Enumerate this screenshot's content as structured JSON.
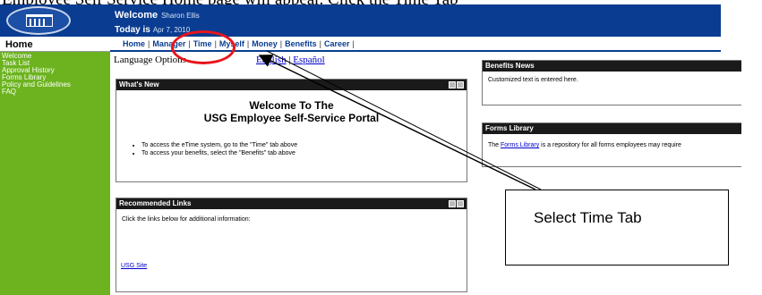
{
  "caption": "Employee Self Service Home page will appear. Click the Time Tab",
  "header": {
    "welcome_label": "Welcome",
    "user_name": "Sharon Ellis",
    "today_label": "Today is",
    "date": "Apr 7, 2010"
  },
  "home_label": "Home",
  "nav_tabs": [
    "Home",
    "Manager",
    "Time",
    "Myself",
    "Money",
    "Benefits",
    "Career"
  ],
  "sidebar": {
    "items": [
      "Welcome",
      "Task List",
      "Approval History",
      "Forms Library",
      "Policy and Guidelines",
      "FAQ"
    ]
  },
  "language": {
    "label": "Language Options",
    "english": "English",
    "separator": "|",
    "spanish": "Español"
  },
  "whats_new": {
    "title": "What's New",
    "heading_line1": "Welcome To The",
    "heading_line2": "USG Employee Self-Service Portal",
    "bullets": [
      "To access the eTime system, go to the \"Time\" tab above",
      "To access your benefits, select the \"Benefits\" tab above"
    ]
  },
  "recommended": {
    "title": "Recommended Links",
    "text": "Click the links below for additional information:",
    "link": "USG Site"
  },
  "benefits_news": {
    "title": "Benefits News",
    "text": "Customized text is entered here."
  },
  "forms_library": {
    "title": "Forms Library",
    "text_prefix": "The ",
    "link": "Forms Library",
    "text_suffix": " is a repository for all forms employees may require"
  },
  "annotation": {
    "callout_text": "Select Time Tab"
  },
  "colors": {
    "header_blue": "#0a3d91",
    "sidebar_green": "#6cb31f",
    "highlight_red": "#e8141b"
  }
}
